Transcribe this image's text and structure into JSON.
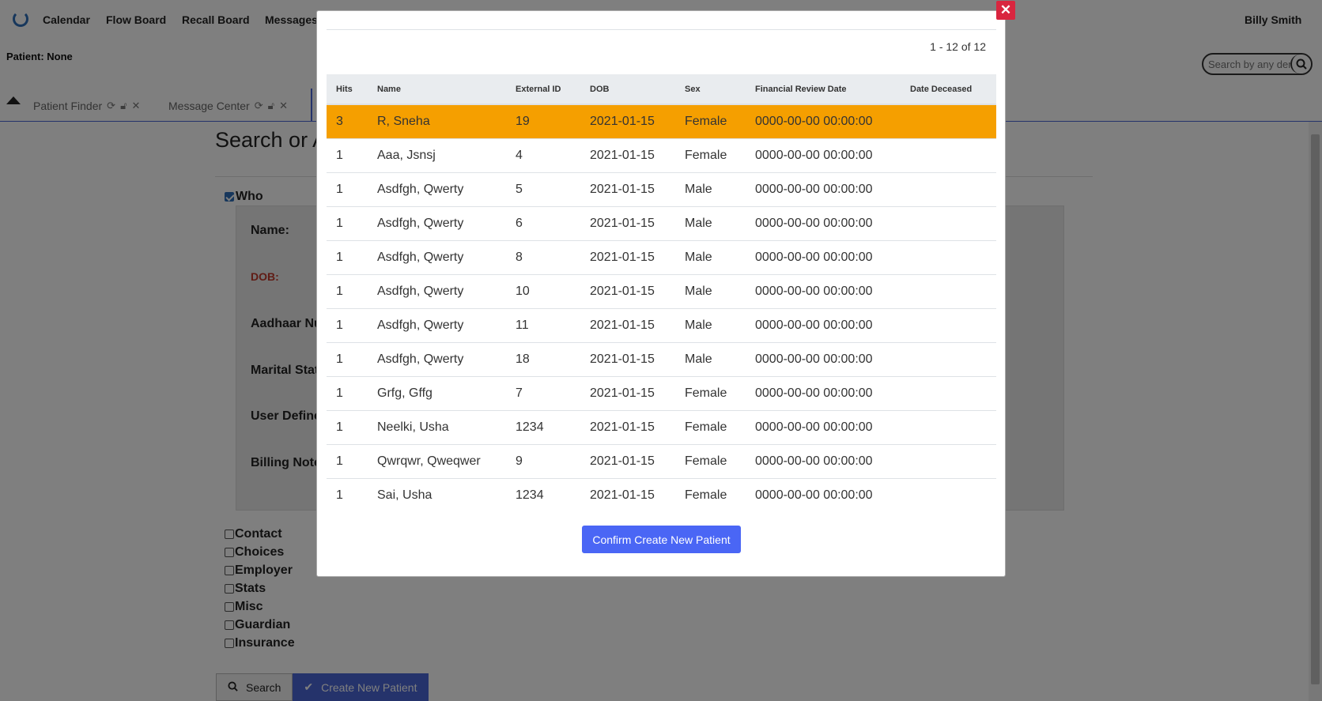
{
  "nav": {
    "items": [
      "Calendar",
      "Flow Board",
      "Recall Board",
      "Messages"
    ],
    "user": "Billy Smith"
  },
  "patient_label": "Patient: None",
  "search": {
    "placeholder": "Search by any demographics"
  },
  "tabs": [
    {
      "label": "Patient Finder"
    },
    {
      "label": "Message Center"
    }
  ],
  "page": {
    "title": "Search or Add Patient",
    "who_label": "Who",
    "fields": [
      "Name:",
      "DOB:",
      "Aadhaar Number:",
      "Marital Status:",
      "User Defined:",
      "Billing Note:"
    ],
    "sections": [
      "Contact",
      "Choices",
      "Employer",
      "Stats",
      "Misc",
      "Guardian",
      "Insurance"
    ],
    "search_btn": "Search",
    "create_btn": "Create New Patient"
  },
  "modal": {
    "pager": "1 - 12 of 12",
    "columns": [
      "Hits",
      "Name",
      "External ID",
      "DOB",
      "Sex",
      "Financial Review Date",
      "Date Deceased"
    ],
    "rows": [
      [
        "3",
        "R, Sneha",
        "19",
        "2021-01-15",
        "Female",
        "0000-00-00 00:00:00",
        ""
      ],
      [
        "1",
        "Aaa, Jsnsj",
        "4",
        "2021-01-15",
        "Female",
        "0000-00-00 00:00:00",
        ""
      ],
      [
        "1",
        "Asdfgh, Qwerty",
        "5",
        "2021-01-15",
        "Male",
        "0000-00-00 00:00:00",
        ""
      ],
      [
        "1",
        "Asdfgh, Qwerty",
        "6",
        "2021-01-15",
        "Male",
        "0000-00-00 00:00:00",
        ""
      ],
      [
        "1",
        "Asdfgh, Qwerty",
        "8",
        "2021-01-15",
        "Male",
        "0000-00-00 00:00:00",
        ""
      ],
      [
        "1",
        "Asdfgh, Qwerty",
        "10",
        "2021-01-15",
        "Male",
        "0000-00-00 00:00:00",
        ""
      ],
      [
        "1",
        "Asdfgh, Qwerty",
        "11",
        "2021-01-15",
        "Male",
        "0000-00-00 00:00:00",
        ""
      ],
      [
        "1",
        "Asdfgh, Qwerty",
        "18",
        "2021-01-15",
        "Male",
        "0000-00-00 00:00:00",
        ""
      ],
      [
        "1",
        "Grfg, Gffg",
        "7",
        "2021-01-15",
        "Female",
        "0000-00-00 00:00:00",
        ""
      ],
      [
        "1",
        "Neelki, Usha",
        "1234",
        "2021-01-15",
        "Female",
        "0000-00-00 00:00:00",
        ""
      ],
      [
        "1",
        "Qwrqwr, Qweqwer",
        "9",
        "2021-01-15",
        "Female",
        "0000-00-00 00:00:00",
        ""
      ],
      [
        "1",
        "Sai, Usha",
        "1234",
        "2021-01-15",
        "Female",
        "0000-00-00 00:00:00",
        ""
      ]
    ],
    "highlighted_row": 0,
    "confirm_btn": "Confirm Create New Patient",
    "close_icon": "close-icon"
  },
  "colors": {
    "accent": "#4a66d6",
    "highlight": "#f59f00",
    "close": "#d9263f",
    "confirm": "#4a66f5"
  }
}
